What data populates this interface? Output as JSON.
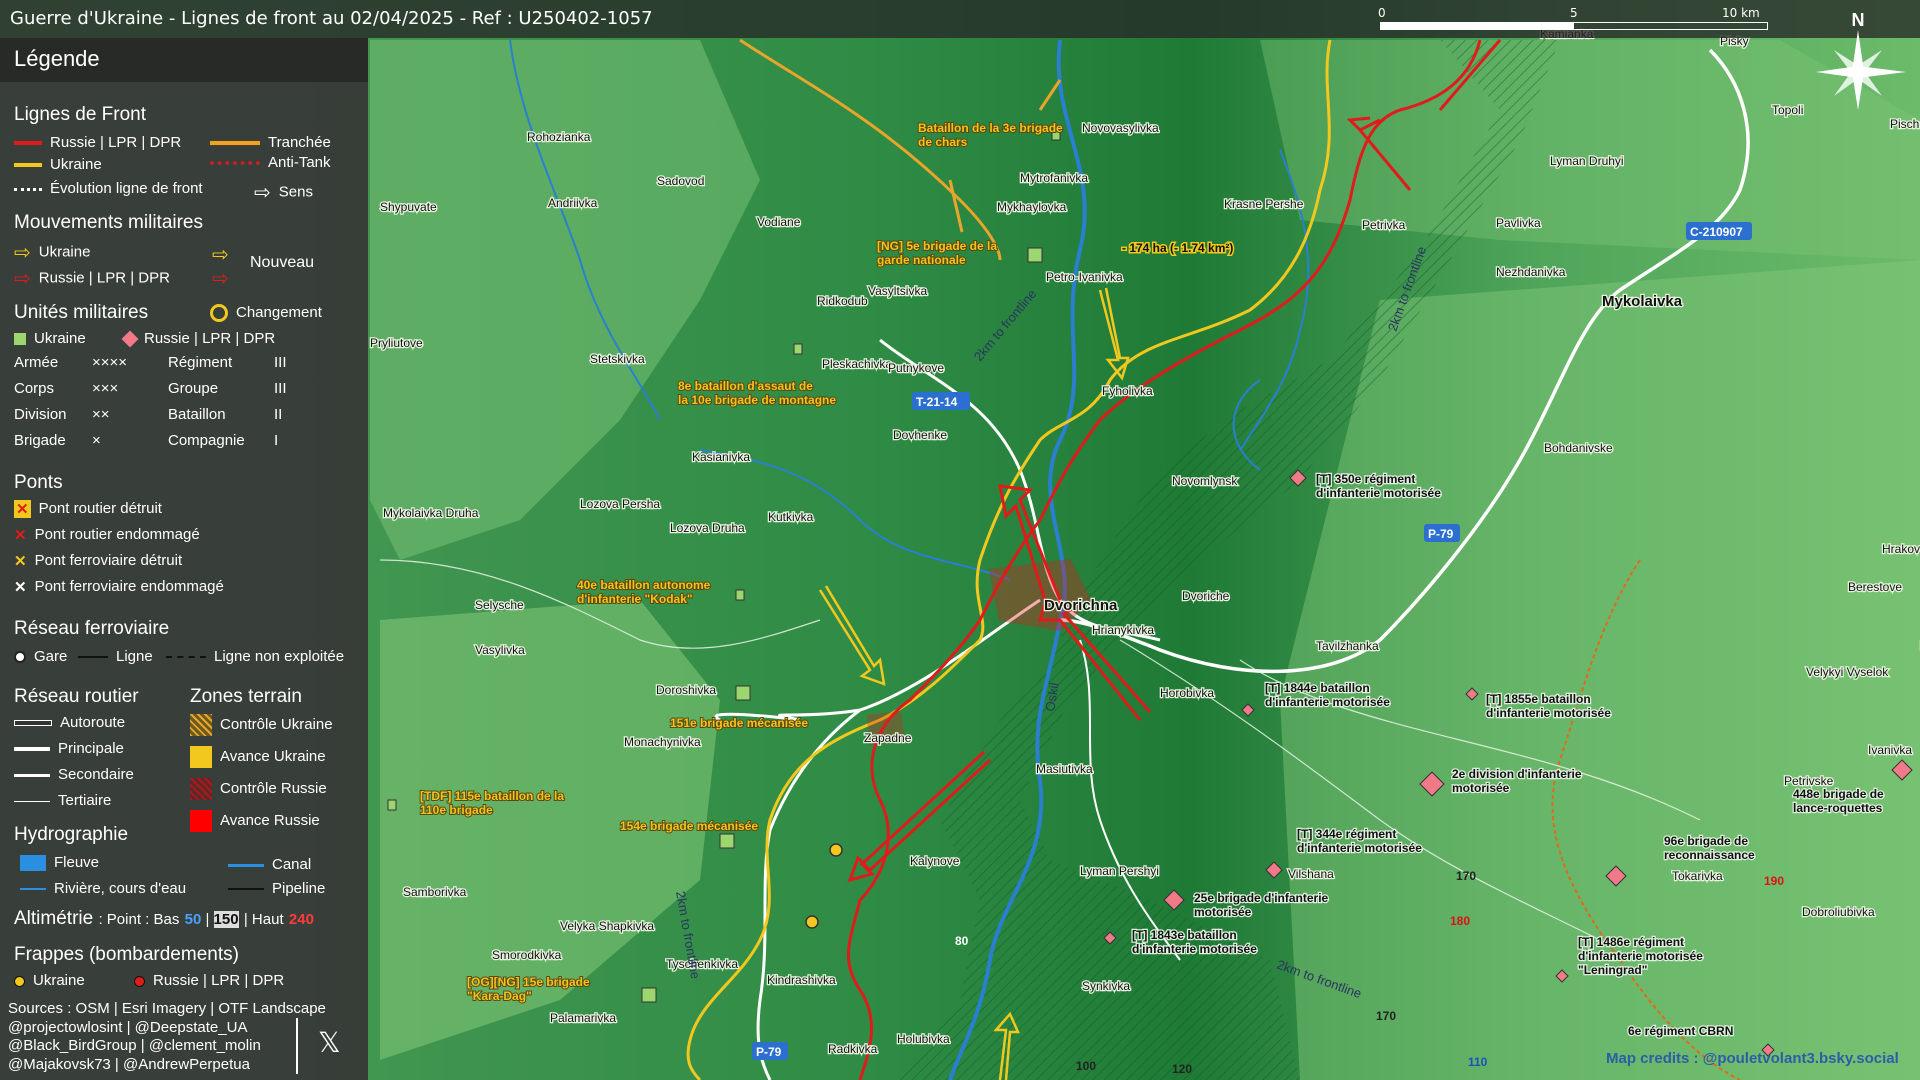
{
  "title": "Guerre d'Ukraine - Lignes de front au 02/04/2025 - Ref : U250402-1057",
  "scale": {
    "labels": [
      "0",
      "5",
      "10 km"
    ]
  },
  "compass": {
    "label": "N"
  },
  "legend": {
    "header": "Légende",
    "front": {
      "title": "Lignes de Front",
      "russia": "Russie | LPR | DPR",
      "ukraine": "Ukraine",
      "trench": "Tranchée",
      "antitank": "Anti-Tank",
      "evolution": "Évolution ligne de front",
      "direction": "Sens"
    },
    "movements": {
      "title": "Mouvements militaires",
      "ukraine": "Ukraine",
      "russia": "Russie | LPR | DPR",
      "new": "Nouveau"
    },
    "units": {
      "title": "Unités militaires",
      "change": "Changement",
      "ukraine": "Ukraine",
      "russia": "Russie | LPR | DPR",
      "rows": [
        {
          "a": "Armée",
          "as": "××××",
          "b": "Régiment",
          "bs": "III"
        },
        {
          "a": "Corps",
          "as": "×××",
          "b": "Groupe",
          "bs": "III"
        },
        {
          "a": "Division",
          "as": "××",
          "b": "Bataillon",
          "bs": "II"
        },
        {
          "a": "Brigade",
          "as": "×",
          "b": "Compagnie",
          "bs": "I"
        }
      ]
    },
    "bridges": {
      "title": "Ponts",
      "items": [
        "Pont routier détruit",
        "Pont routier endommagé",
        "Pont ferroviaire détruit",
        "Pont ferroviaire endommagé"
      ]
    },
    "rail": {
      "title": "Réseau ferroviaire",
      "station": "Gare",
      "line": "Ligne",
      "unused": "Ligne non exploitée"
    },
    "roads": {
      "title": "Réseau routier",
      "items": [
        "Autoroute",
        "Principale",
        "Secondaire",
        "Tertiaire"
      ]
    },
    "zones": {
      "title": "Zones terrain",
      "items": [
        "Contrôle Ukraine",
        "Avance Ukraine",
        "Contrôle Russie",
        "Avance Russie"
      ]
    },
    "hydro": {
      "title": "Hydrographie",
      "river": "Fleuve",
      "canal": "Canal",
      "stream": "Rivière, cours d'eau",
      "pipeline": "Pipeline"
    },
    "altimetry": {
      "title": "Altimétrie",
      "point": ": Point : Bas",
      "low": "50",
      "mid": "150",
      "high_label": "| Haut",
      "high": "240"
    },
    "strikes": {
      "title": "Frappes (bombardements)",
      "ukraine": "Ukraine",
      "russia": "Russie | LPR | DPR"
    },
    "credits": [
      "Sources : OSM | Esri Imagery | OTF Landscape",
      "@projectowlosint | @Deepstate_UA",
      "@Black_BirdGroup | @clement_molin",
      "@Majakovsk73 | @AndrewPerpetua"
    ]
  },
  "map_credit": "Map credits : @pouletvolant3.bsky.social",
  "colors": {
    "russia": "#e01b1b",
    "ukraine": "#f2c81e",
    "terrain_dark": "#1f7f3a",
    "terrain_light": "#8ccf7e"
  },
  "places": [
    "Kamianka",
    "Pisky",
    "Topoli",
    "Pischane",
    "Rohozianka",
    "Sadovod",
    "Andriivka",
    "Shypuvate",
    "Vodiane",
    "Novovasylivka",
    "Mytrofanivka",
    "Mykhaylovka",
    "Krasne Pershe",
    "Petrivka",
    "Pavlivka",
    "Lyman Druhyi",
    "Ridkodub",
    "Vasyltsivka",
    "Petro-Ivanivka",
    "Nezhdanivka",
    "Mykolaivka",
    "Pryliutove",
    "Stetskivka",
    "Pleskachivka",
    "Putnykove",
    "Fyholivka",
    "Dovhenke",
    "Bohdanivske",
    "Kasianivka",
    "Novomlynsk",
    "Mykolaivka Druha",
    "Lozova Persha",
    "Kutkivka",
    "Lozova Druha",
    "Hrakove",
    "Dvorichna",
    "Dvoriche",
    "Hrianykivka",
    "Selysche",
    "Berestove",
    "Tavilzhanka",
    "Vasylivka",
    "Novoiehorivka",
    "Horobivka",
    "Doroshivka",
    "Velykyi Vyselok",
    "Zapadne",
    "Monachynivka",
    "Masiutivka",
    "Ivanivka",
    "Petrivske",
    "Kalynove",
    "Lyman Pershyi",
    "Vilshana",
    "Tokarivka",
    "Samborivka",
    "Velyka Shapkivka",
    "Dobroliubivka",
    "Smorodkivka",
    "Tyschenkivka",
    "Kindrashivka",
    "Synkivka",
    "Palamarivka",
    "Radkivka",
    "Holubivka"
  ],
  "roads_labels": [
    "C-210907",
    "T-21-14",
    "P-79",
    "P-79",
    "80"
  ],
  "annotations": [
    "2km to frontline",
    "2km to frontline",
    "2km to frontline",
    "2km to frontline",
    "- 174 ha (- 1.74 km²)",
    "Oskil"
  ],
  "elevations": [
    "170",
    "180",
    "190",
    "170",
    "110",
    "100",
    "120"
  ],
  "units": [
    {
      "side": "ukraine",
      "label": "Bataillon de la 3e brigade de chars",
      "echelon": "II"
    },
    {
      "side": "ukraine",
      "label": "[NG] 5e brigade de la garde nationale",
      "echelon": "×"
    },
    {
      "side": "ukraine",
      "label": "8e bataillon d'assaut de la 10e brigade de montagne",
      "echelon": "II"
    },
    {
      "side": "ukraine",
      "label": "40e bataillon autonome d'infanterie \"Kodak\"",
      "echelon": "II"
    },
    {
      "side": "ukraine",
      "label": "151e brigade mécanisée",
      "echelon": "×"
    },
    {
      "side": "ukraine",
      "label": "[TDF] 115e bataillon de la 110e brigade",
      "echelon": "II"
    },
    {
      "side": "ukraine",
      "label": "154e brigade mécanisée",
      "echelon": "×"
    },
    {
      "side": "ukraine",
      "label": "[OG][NG] 15e brigade \"Kara-Dag\"",
      "echelon": "×"
    },
    {
      "side": "russia",
      "label": "[T] 350e régiment d'infanterie motorisée",
      "echelon": "III"
    },
    {
      "side": "russia",
      "label": "[T] 1844e bataillon d'infanterie motorisée",
      "echelon": "II"
    },
    {
      "side": "russia",
      "label": "[T] 1855e bataillon d'infanterie motorisée",
      "echelon": "II"
    },
    {
      "side": "russia",
      "label": "2e division d'infanterie motorisée",
      "echelon": "××"
    },
    {
      "side": "russia",
      "label": "448e brigade de lance-roquettes",
      "echelon": "×"
    },
    {
      "side": "russia",
      "label": "[T] 344e régiment d'infanterie motorisée",
      "echelon": "III"
    },
    {
      "side": "russia",
      "label": "96e brigade de reconnaissance",
      "echelon": "×"
    },
    {
      "side": "russia",
      "label": "25e brigade d'infanterie motorisée",
      "echelon": "×"
    },
    {
      "side": "russia",
      "label": "[T] 1843e bataillon d'infanterie motorisée",
      "echelon": "II"
    },
    {
      "side": "russia",
      "label": "[T] 1486e régiment d'infanterie motorisée \"Leningrad\"",
      "echelon": "III"
    },
    {
      "side": "russia",
      "label": "6e régiment CBRN",
      "echelon": "III"
    }
  ]
}
